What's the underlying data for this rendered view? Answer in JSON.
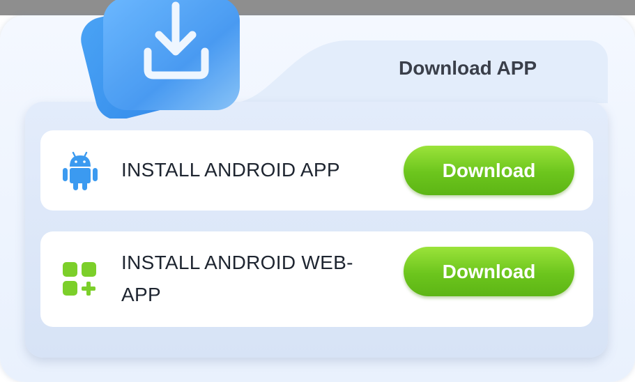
{
  "modal": {
    "title": "Download APP"
  },
  "rows": [
    {
      "label": "INSTALL ANDROID APP",
      "icon": "android-icon",
      "button_label": "Download"
    },
    {
      "label": "INSTALL ANDROID WEB-APP",
      "icon": "apps-add-icon",
      "button_label": "Download"
    }
  ],
  "colors": {
    "accent_green": "#6cc51d",
    "android_blue": "#3b9af0",
    "icon_green": "#7ccf2a",
    "title_text": "#3a3f4a"
  }
}
